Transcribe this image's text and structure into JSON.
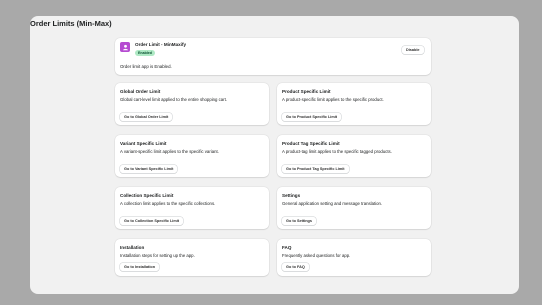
{
  "page": {
    "title": "Order Limits (Min-Max)"
  },
  "app_card": {
    "name": "Order Limit - MinMaxify",
    "badge": "Enabled",
    "status_text": "Order limit app is Enabled.",
    "disable_label": "Disable",
    "logo_icon": "person-icon",
    "logo_color": "#b54bd1",
    "badge_color": "#aee9c4"
  },
  "features": [
    {
      "title": "Global Order Limit",
      "description": "Global cart-level limit applied to the entire shopping cart.",
      "button": "Go to Global Order Limit"
    },
    {
      "title": "Product Specific Limit",
      "description": "A product-specific limit applies to the specific product.",
      "button": "Go to Product Specific Limit"
    },
    {
      "title": "Variant Specific Limit",
      "description": "A variant-specific limit applies to the specific variant.",
      "button": "Go to Variant Specific Limit"
    },
    {
      "title": "Product Tag Specific Limit",
      "description": "A product-tag limit applies to the specific tagged products.",
      "button": "Go to Product Tag Specific Limit"
    },
    {
      "title": "Collection Specific Limit",
      "description": "A collection limit applies to the specific collections.",
      "button": "Go to Collection Specific Limit"
    },
    {
      "title": "Settings",
      "description": "General application setting and message translation.",
      "button": "Go to Settings"
    },
    {
      "title": "Installation",
      "description": "Installation steps for setting up the app.",
      "button": "Go to Installation"
    },
    {
      "title": "FAQ",
      "description": "Frequently asked questions for app.",
      "button": "Go to FAQ"
    }
  ]
}
